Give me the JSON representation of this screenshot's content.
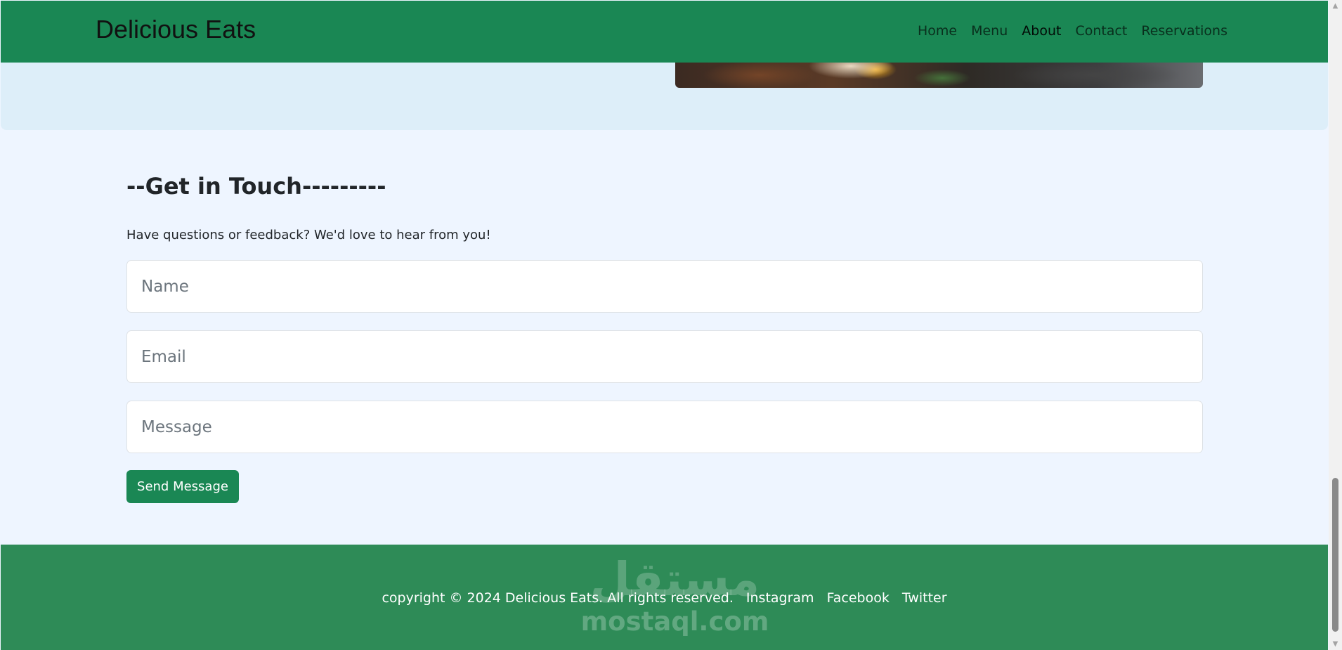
{
  "navbar": {
    "brand": "Delicious Eats",
    "links": [
      {
        "label": "Home",
        "active": false
      },
      {
        "label": "Menu",
        "active": false
      },
      {
        "label": "About",
        "active": true
      },
      {
        "label": "Contact",
        "active": false
      },
      {
        "label": "Reservations",
        "active": false
      }
    ]
  },
  "hero": {
    "image_icon": "food-photo"
  },
  "contact": {
    "title": "--Get in Touch---------",
    "subtitle": "Have questions or feedback? We'd love to hear from you!",
    "name_placeholder": "Name",
    "email_placeholder": "Email",
    "message_placeholder": "Message",
    "send_label": "Send Message"
  },
  "footer": {
    "copyright": "copyright © 2024 Delicious Eats. All rights reserved.",
    "links": [
      "Instagram",
      "Facebook",
      "Twitter"
    ],
    "watermark_arabic": "مستقل",
    "watermark_latin": "mostaql.com"
  },
  "colors": {
    "brand_green": "#1a8754",
    "footer_green": "#2e8b57",
    "page_background": "#eef5ff",
    "hero_background": "#ddeef9"
  },
  "scrollbar": {
    "up_icon": "arrow-up-icon",
    "down_icon": "arrow-down-icon"
  }
}
